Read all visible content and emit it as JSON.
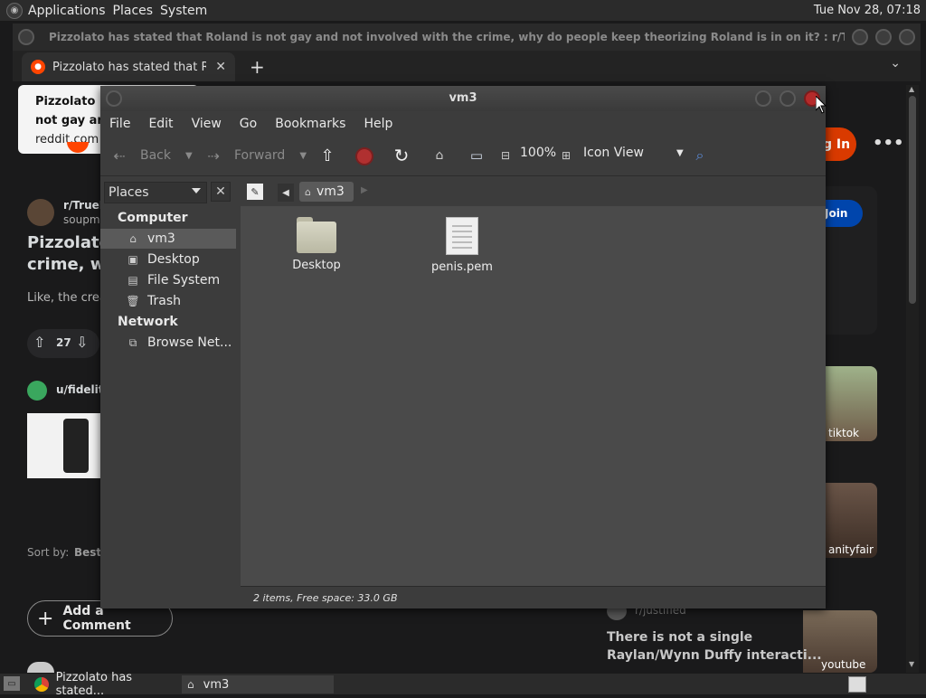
{
  "top_panel": {
    "menus": [
      "Applications",
      "Places",
      "System"
    ],
    "clock": "Tue Nov 28, 07:18"
  },
  "browser": {
    "window_title": "Pizzolato has stated that Roland is not gay and not involved with the crime, why do people keep theorizing Roland is in on it? : r/TrueDetective...",
    "tab_title": "Pizzolato has stated that Rola",
    "tab_close": "✕",
    "new_tab": "+",
    "tab_menu": "⌄"
  },
  "reddit": {
    "popup_title_1": "Pizzolato h",
    "popup_title_2": "not gay and",
    "popup_url": "reddit.com",
    "subreddit": "r/TrueD",
    "author": "soupma",
    "post_title_1": "Pizzolato",
    "post_title_2": "crime, wh",
    "body": "Like, the crea",
    "votes": "27",
    "ad_user": "u/fidelity",
    "sort_label": "Sort by:",
    "sort_value": "Best",
    "add_comment": "Add a Comment",
    "login": "g In",
    "join": "Join",
    "thumb_1": "tiktok",
    "thumb_2": "anityfair",
    "thumb_3": "youtube",
    "comment_user": "r/justified",
    "comment_1": "There is not a single",
    "comment_2": "Raylan/Wynn Duffy interacti..."
  },
  "file_manager": {
    "title": "vm3",
    "menus": [
      "File",
      "Edit",
      "View",
      "Go",
      "Bookmarks",
      "Help"
    ],
    "toolbar": {
      "back": "Back",
      "forward": "Forward",
      "zoom": "100%",
      "view_mode": "Icon View"
    },
    "places_label": "Places",
    "breadcrumb": "vm3",
    "sidebar": {
      "computer_heading": "Computer",
      "computer_items": [
        "vm3",
        "Desktop",
        "File System",
        "Trash"
      ],
      "network_heading": "Network",
      "network_items": [
        "Browse Net..."
      ]
    },
    "files": [
      {
        "name": "Desktop",
        "type": "folder"
      },
      {
        "name": "penis.pem",
        "type": "file"
      }
    ],
    "status": "2 items, Free space: 33.0 GB"
  },
  "taskbar": {
    "items": [
      "Pizzolato has stated...",
      "vm3"
    ]
  }
}
